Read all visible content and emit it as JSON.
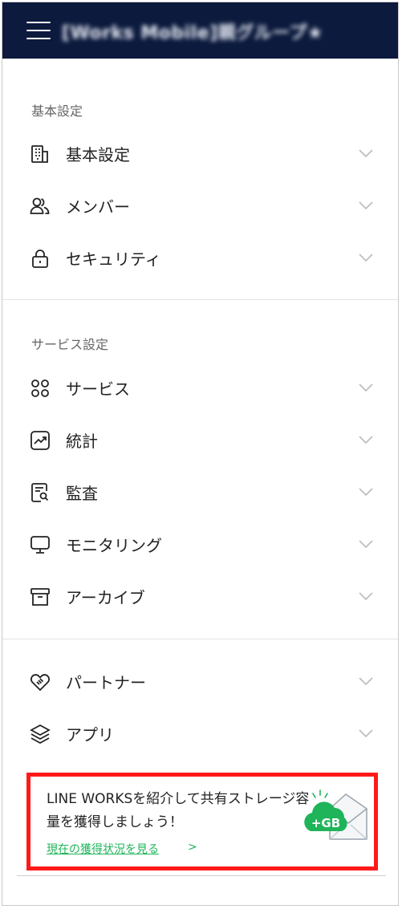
{
  "header": {
    "menu_icon": "hamburger-menu-icon",
    "title": "[Works Mobile]親グループ★"
  },
  "sections": [
    {
      "label": "基本設定",
      "items": [
        {
          "label": "基本設定",
          "icon": "building-icon"
        },
        {
          "label": "メンバー",
          "icon": "members-icon"
        },
        {
          "label": "セキュリティ",
          "icon": "lock-icon"
        }
      ]
    },
    {
      "label": "サービス設定",
      "items": [
        {
          "label": "サービス",
          "icon": "apps-grid-icon"
        },
        {
          "label": "統計",
          "icon": "chart-icon"
        },
        {
          "label": "監査",
          "icon": "audit-icon"
        },
        {
          "label": "モニタリング",
          "icon": "monitor-icon"
        },
        {
          "label": "アーカイブ",
          "icon": "archive-icon"
        }
      ]
    },
    {
      "label": "",
      "items": [
        {
          "label": "パートナー",
          "icon": "handshake-heart-icon"
        },
        {
          "label": "アプリ",
          "icon": "layers-icon"
        }
      ]
    }
  ],
  "promo": {
    "text": "LINE WORKSを紹介して共有ストレージ容量を獲得しましょう！",
    "link": "現在の獲得状況を見る",
    "link_arrow": ">",
    "badge": "+GB",
    "accent": "#1fb45a",
    "border_color": "#ff1a1a"
  },
  "colors": {
    "header_bg": "#0c1a3d"
  }
}
